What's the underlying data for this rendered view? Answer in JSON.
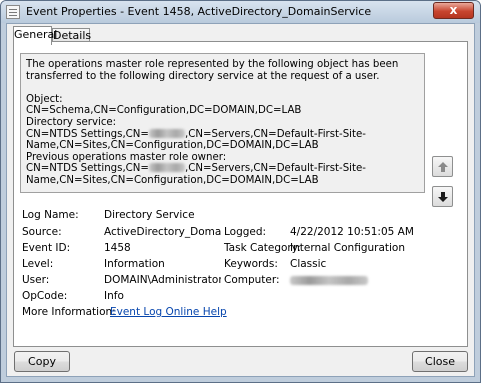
{
  "window": {
    "title": "Event Properties - Event 1458, ActiveDirectory_DomainService",
    "close_glyph": "x"
  },
  "tabs": [
    {
      "label": "General",
      "selected": true
    },
    {
      "label": "Details",
      "selected": false
    }
  ],
  "description": {
    "text1": "The operations master role represented by the following object has been transferred to the following directory service at the request of a user.\n\nObject:\nCN=Schema,CN=Configuration,DC=DOMAIN,DC=LAB\nDirectory service:\nCN=NTDS Settings,CN=",
    "text2": ",CN=Servers,CN=Default-First-Site-Name,CN=Sites,CN=Configuration,DC=DOMAIN,DC=LAB\nPrevious operations master role owner:\nCN=NTDS Settings,CN=",
    "text3": ",CN=Servers,CN=Default-First-Site-Name,CN=Sites,CN=Configuration,DC=DOMAIN,DC=LAB"
  },
  "fields": {
    "log_name": {
      "label": "Log Name:",
      "value": "Directory Service"
    },
    "source": {
      "label": "Source:",
      "value": "ActiveDirectory_DomainService"
    },
    "event_id": {
      "label": "Event ID:",
      "value": "1458"
    },
    "level": {
      "label": "Level:",
      "value": "Information"
    },
    "user": {
      "label": "User:",
      "value": "DOMAIN\\Administrator"
    },
    "opcode": {
      "label": "OpCode:",
      "value": "Info"
    },
    "more_info": {
      "label": "More Information:",
      "link": "Event Log Online Help"
    },
    "logged": {
      "label": "Logged:",
      "value": "4/22/2012 10:51:05 AM"
    },
    "task_category": {
      "label": "Task Category:",
      "value": "Internal Configuration"
    },
    "keywords": {
      "label": "Keywords:",
      "value": "Classic"
    },
    "computer": {
      "label": "Computer:"
    }
  },
  "buttons": {
    "copy": "Copy",
    "close": "Close"
  },
  "icons": {
    "app": "event-properties-icon",
    "up": "arrow-up-icon",
    "down": "arrow-down-icon"
  }
}
